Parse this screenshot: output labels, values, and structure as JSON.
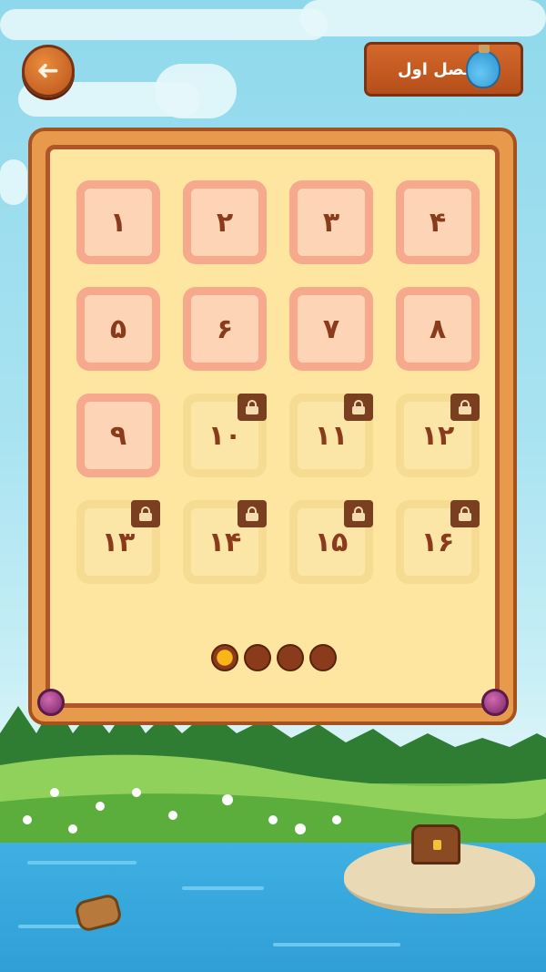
{
  "header": {
    "back_icon": "arrow-left-icon",
    "chapter_title": "فصل اول",
    "chapter_icon": "potion-icon"
  },
  "levels": [
    {
      "label": "۱",
      "locked": false
    },
    {
      "label": "۲",
      "locked": false
    },
    {
      "label": "۳",
      "locked": false
    },
    {
      "label": "۴",
      "locked": false
    },
    {
      "label": "۵",
      "locked": false
    },
    {
      "label": "۶",
      "locked": false
    },
    {
      "label": "۷",
      "locked": false
    },
    {
      "label": "۸",
      "locked": false
    },
    {
      "label": "۹",
      "locked": false
    },
    {
      "label": "۱۰",
      "locked": true
    },
    {
      "label": "۱۱",
      "locked": true
    },
    {
      "label": "۱۲",
      "locked": true
    },
    {
      "label": "۱۳",
      "locked": true
    },
    {
      "label": "۱۴",
      "locked": true
    },
    {
      "label": "۱۵",
      "locked": true
    },
    {
      "label": "۱۶",
      "locked": true
    }
  ],
  "pagination": {
    "total": 4,
    "current": 1
  },
  "colors": {
    "open_tile": "#f6a98c",
    "locked_tile": "#f5dc92",
    "board_frame": "#e89a4c",
    "number_text": "#8a3b1c"
  }
}
